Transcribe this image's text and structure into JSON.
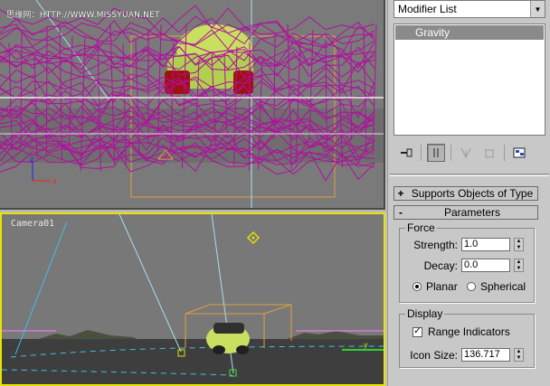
{
  "watermark": "思缘网：HTTP://WWW.MISSYUAN.NET",
  "viewports": {
    "front": {
      "axis_z": "z",
      "axis_x": "x"
    },
    "camera": {
      "label": "Camera01",
      "axis_y": "y"
    }
  },
  "panel": {
    "modifier_list": "Modifier List",
    "modifier_stack": [
      "Gravity"
    ],
    "rollouts": {
      "supports": {
        "sign": "+",
        "label": "Supports Objects of Type"
      },
      "parameters": {
        "sign": "-",
        "label": "Parameters"
      }
    },
    "force": {
      "title": "Force",
      "strength_label": "Strength:",
      "strength_value": "1.0",
      "decay_label": "Decay:",
      "decay_value": "0.0",
      "planar_label": "Planar",
      "spherical_label": "Spherical",
      "selected": "Planar"
    },
    "display": {
      "title": "Display",
      "range_indicators_label": "Range Indicators",
      "range_indicators_checked": true,
      "icon_size_label": "Icon Size:",
      "icon_size_value": "136.717"
    }
  },
  "colors": {
    "viewport_bg": "#7a7a7a",
    "active_viewport_border": "#e6e600",
    "wireframe": "#b0109e",
    "car_body": "#c8e060",
    "gizmo": "#e0a040",
    "camera_lines": "#a8e0f0"
  }
}
